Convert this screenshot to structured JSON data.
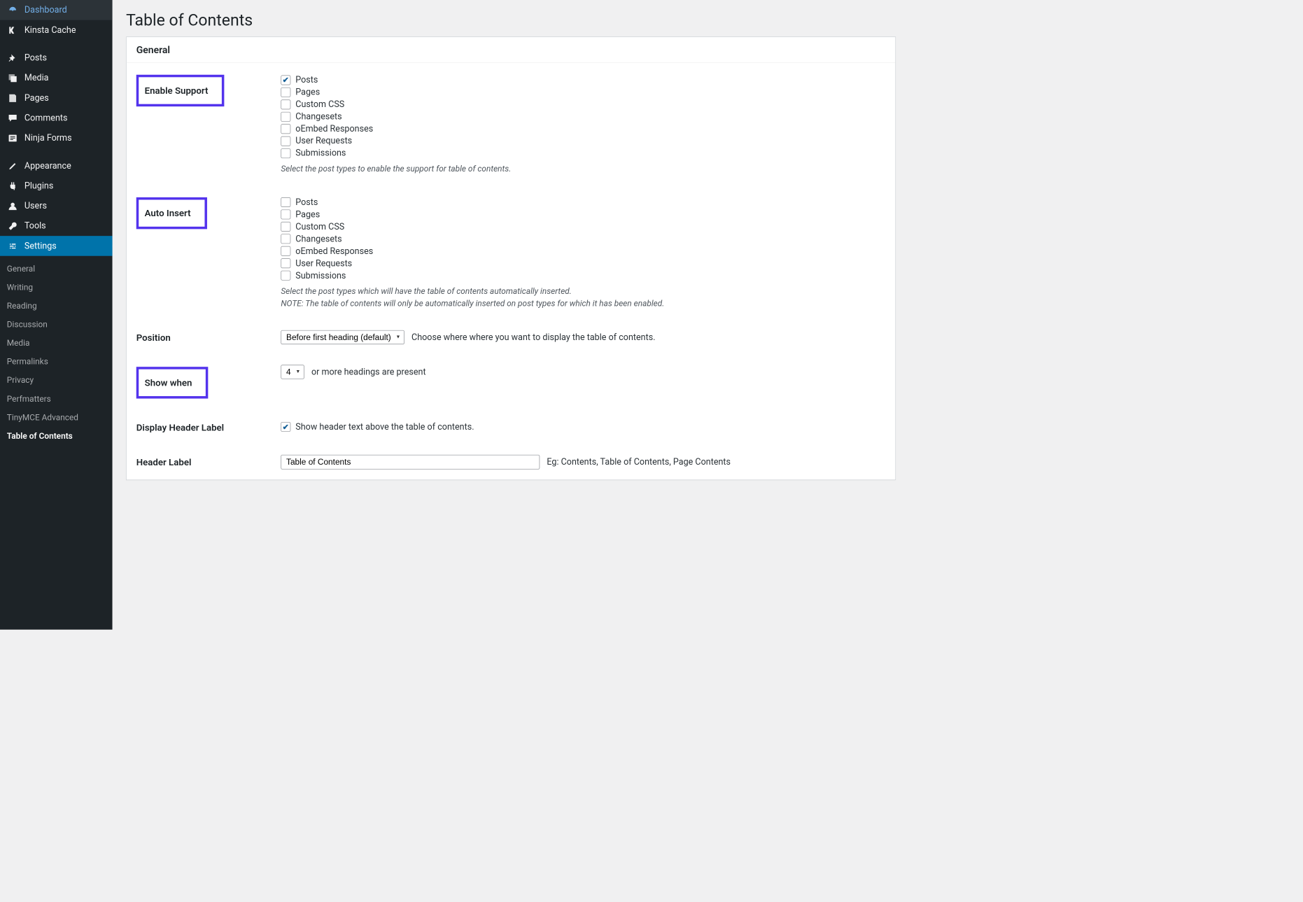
{
  "sidebar": {
    "nav": [
      {
        "icon": "dashboard",
        "label": "Dashboard"
      },
      {
        "icon": "kinsta",
        "label": "Kinsta Cache"
      },
      {
        "icon": "pin",
        "label": "Posts"
      },
      {
        "icon": "media",
        "label": "Media"
      },
      {
        "icon": "pages",
        "label": "Pages"
      },
      {
        "icon": "comments",
        "label": "Comments"
      },
      {
        "icon": "forms",
        "label": "Ninja Forms"
      },
      {
        "icon": "appearance",
        "label": "Appearance"
      },
      {
        "icon": "plugins",
        "label": "Plugins"
      },
      {
        "icon": "users",
        "label": "Users"
      },
      {
        "icon": "tools",
        "label": "Tools"
      },
      {
        "icon": "settings",
        "label": "Settings",
        "active": true
      }
    ],
    "sub": [
      "General",
      "Writing",
      "Reading",
      "Discussion",
      "Media",
      "Permalinks",
      "Privacy",
      "Perfmatters",
      "TinyMCE Advanced",
      "Table of Contents"
    ],
    "sub_current_index": 9
  },
  "page": {
    "title": "Table of Contents",
    "panel_heading": "General"
  },
  "enable_support": {
    "label": "Enable Support",
    "options": [
      "Posts",
      "Pages",
      "Custom CSS",
      "Changesets",
      "oEmbed Responses",
      "User Requests",
      "Submissions"
    ],
    "checked": [
      true,
      false,
      false,
      false,
      false,
      false,
      false
    ],
    "description": "Select the post types to enable the support for table of contents."
  },
  "auto_insert": {
    "label": "Auto Insert",
    "options": [
      "Posts",
      "Pages",
      "Custom CSS",
      "Changesets",
      "oEmbed Responses",
      "User Requests",
      "Submissions"
    ],
    "checked": [
      false,
      false,
      false,
      false,
      false,
      false,
      false
    ],
    "description": "Select the post types which will have the table of contents automatically inserted.",
    "note": "NOTE: The table of contents will only be automatically inserted on post types for which it has been enabled."
  },
  "position": {
    "label": "Position",
    "value": "Before first heading (default)",
    "hint": "Choose where where you want to display the table of contents."
  },
  "show_when": {
    "label": "Show when",
    "value": "4",
    "suffix": "or more headings are present"
  },
  "display_header": {
    "label": "Display Header Label",
    "checked": true,
    "text": "Show header text above the table of contents."
  },
  "header_label": {
    "label": "Header Label",
    "value": "Table of Contents",
    "eg": "Eg: Contents, Table of Contents, Page Contents"
  }
}
